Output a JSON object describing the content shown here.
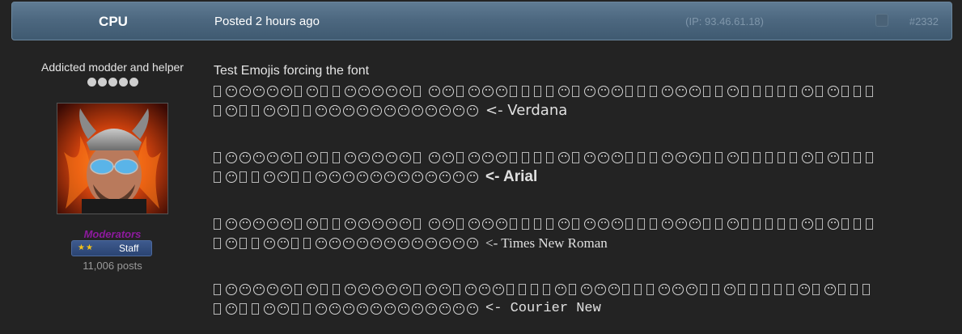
{
  "header": {
    "author": "CPU",
    "posted_label": "Posted",
    "posted_time": "2 hours ago",
    "ip": "(IP: 93.46.61.18)",
    "post_number": "#2332"
  },
  "author": {
    "title": "Addicted modder and helper",
    "rank_pips": 5,
    "avatar": "avatar-image",
    "group": "Moderators",
    "badge_label": "Staff",
    "post_count": "11,006 posts"
  },
  "body": {
    "intro": "Test Emojis forcing the font",
    "blocks": [
      {
        "line1": "□😄😅😆😅😊□😊□□🙂😉😇😍😘□ ☺😙□😚😛😜□□□□😐□😶😏😒□□□😴😌😛□□😪□□□□□😵□😎□□□",
        "line2": "□☹□□😲😝□□😟😀😐😧😬😦😯😕😟😧😑😳",
        "label": "<- Verdana"
      },
      {
        "line1": "□😄😅😆😅😊□😊□□🙂😉😇😍😘□ ☺😙□😚😛😜□□□□😐□😶😏😒□□□😴😌😛□□😪□□□□□😵□😎□□□",
        "line2": "□☹□□😲😝□□😟😀😐😧😬😦😯😕😟😧😑😳",
        "label": "<- Arial"
      },
      {
        "line1": "□😄😅😆😅😊□😊□□🙂😉😇😍😘□ ☺😙□😚😛😜□□□□😐□😶😏😒□□□😴😌😛□□😪□□□□□😵□😎□□□",
        "line2": "□☹□□😲😝□□😟😀😐😧😬😦😯😕😟😧😑😳",
        "label": "<- Times New Roman"
      },
      {
        "line1": "□😄😅😆😅😊□😊□□🙂😉😇😍😘□☺😙□😚😛😜□□□□😐□😶😏😒□□□😴😌😛□□😪□□□□□😵□😎□□□",
        "line2": "□☹□□😲😝□□😟😀😐😧😬😦😯😕😟😧😑😳",
        "label": "<- Courier New"
      }
    ]
  },
  "colors": {
    "header_bg": "#4d6880",
    "page_bg": "#232323",
    "group_color": "#8e1a9e",
    "badge_bg": "#2a4472",
    "star_color": "#f3c21a"
  }
}
